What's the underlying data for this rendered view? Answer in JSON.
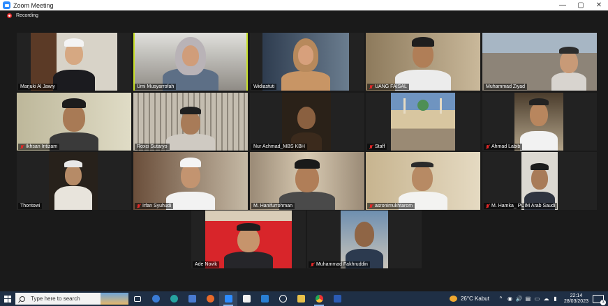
{
  "window": {
    "title": "Zoom Meeting",
    "minimize": "—",
    "maximize": "▢",
    "close": "✕"
  },
  "recording": {
    "label": "Recording"
  },
  "participants": [
    {
      "name": "Marjuki Al Jawiy",
      "muted": false
    },
    {
      "name": "Umi Musyarrofah",
      "muted": false,
      "active_speaker": true
    },
    {
      "name": "Widiastuti",
      "muted": false
    },
    {
      "name": "UANG FAISAL",
      "muted": true
    },
    {
      "name": "Muhammad Ziyad",
      "muted": false
    },
    {
      "name": "Ikhsan Intizam",
      "muted": true
    },
    {
      "name": "Roxci Sutaryo",
      "muted": false
    },
    {
      "name": "Nur Achmad_MBS KBH",
      "muted": false
    },
    {
      "name": "Staff",
      "muted": true
    },
    {
      "name": "Ahmad Labib",
      "muted": true
    },
    {
      "name": "Thontowi",
      "muted": false
    },
    {
      "name": "Irfan Syuhudi",
      "muted": true
    },
    {
      "name": "M. Hanifurrohman",
      "muted": false
    },
    {
      "name": "asronimukhtarom",
      "muted": true
    },
    {
      "name": "M. Hamka_ PCIM Arab Saudi",
      "muted": true
    },
    {
      "name": "Ade Novik",
      "muted": false
    },
    {
      "name": "Muhammad Fakhruddin",
      "muted": true
    }
  ],
  "taskbar": {
    "search_placeholder": "Type here to search",
    "weather": "26°C  Kabut",
    "time": "22:14",
    "date": "28/03/2023",
    "notification_count": "3",
    "tray_icons": [
      "^",
      "◉",
      "🔊",
      "▤",
      "▭",
      "☁",
      "▮"
    ]
  }
}
